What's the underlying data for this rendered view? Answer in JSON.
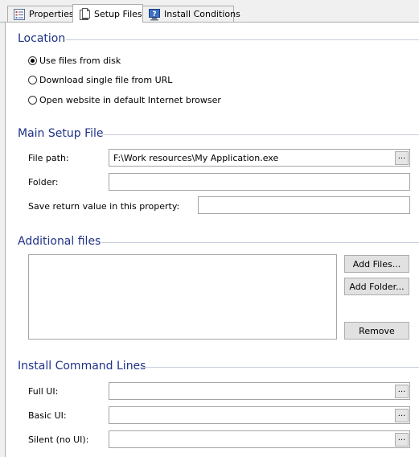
{
  "tabs": [
    {
      "label": "Properties",
      "icon": "properties-list-icon"
    },
    {
      "label": "Setup Files",
      "icon": "document-pages-icon"
    },
    {
      "label": "Install Conditions",
      "icon": "help-monitor-icon"
    }
  ],
  "active_tab": "Setup Files",
  "location": {
    "title": "Location",
    "options": [
      {
        "label": "Use files from disk",
        "selected": true
      },
      {
        "label": "Download single file from URL",
        "selected": false
      },
      {
        "label": "Open website in default Internet browser",
        "selected": false
      }
    ]
  },
  "main_setup": {
    "title": "Main Setup File",
    "file_path_label": "File path:",
    "file_path_value": "F:\\Work resources\\My Application.exe",
    "folder_label": "Folder:",
    "folder_value": "",
    "return_label": "Save return value in this property:",
    "return_value": ""
  },
  "additional_files": {
    "title": "Additional files",
    "items": [],
    "add_files_label": "Add Files...",
    "add_folder_label": "Add Folder...",
    "remove_label": "Remove"
  },
  "install_command_lines": {
    "title": "Install Command Lines",
    "full_ui_label": "Full UI:",
    "full_ui_value": "",
    "basic_ui_label": "Basic UI:",
    "basic_ui_value": "",
    "silent_label": "Silent (no UI):",
    "silent_value": ""
  },
  "browse_label": "...",
  "colors": {
    "section_title": "#1e3287",
    "section_rule": "#c8cedb",
    "panel_bg": "#ffffff",
    "window_bg": "#f0f0f0"
  }
}
